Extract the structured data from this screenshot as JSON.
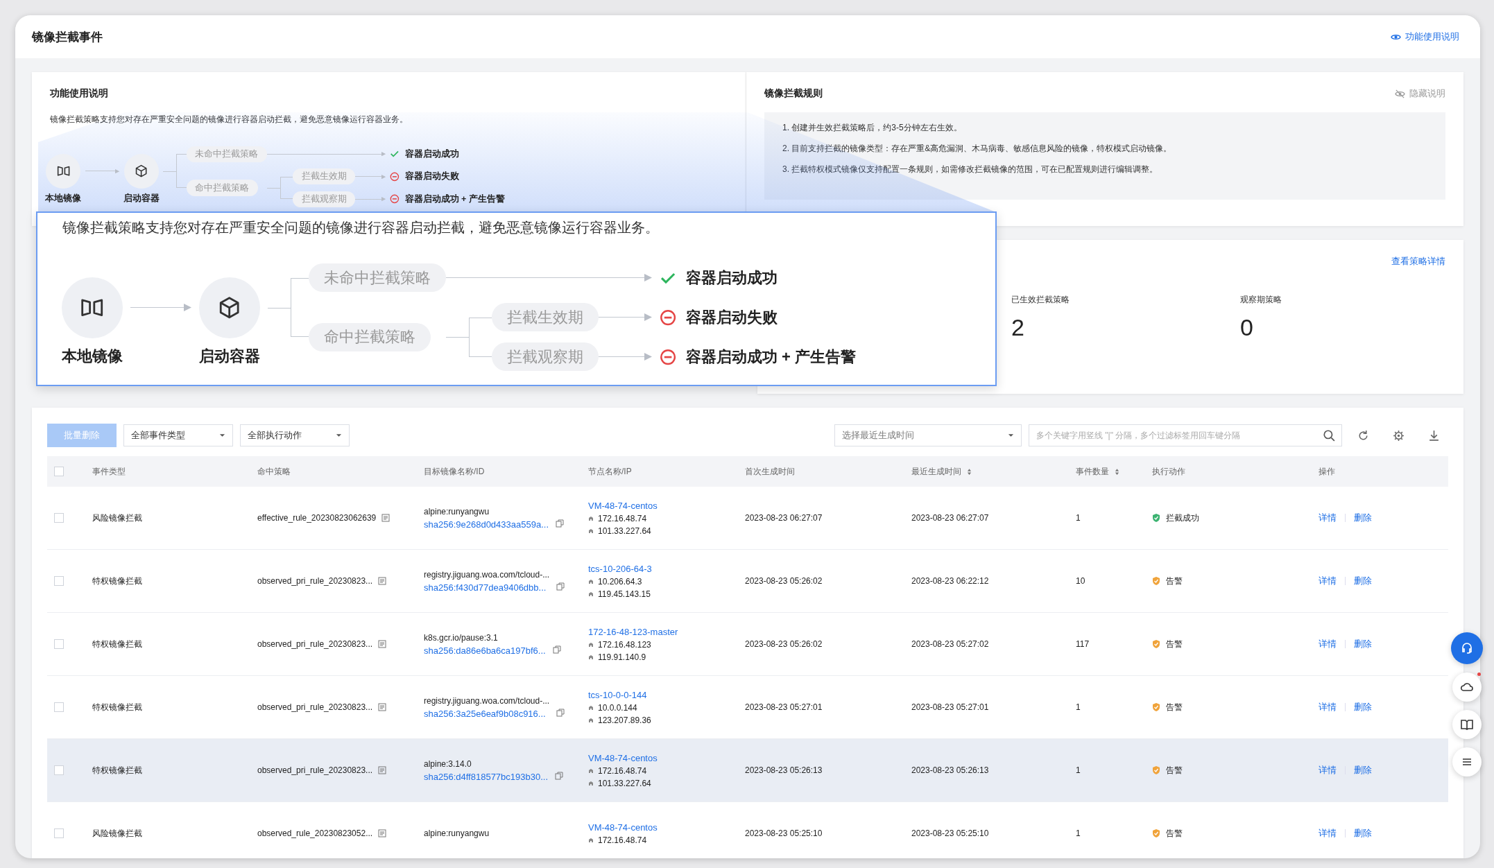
{
  "header": {
    "title": "镜像拦截事件",
    "help_link": "功能使用说明"
  },
  "help": {
    "title": "功能使用说明",
    "description": "镜像拦截策略支持您对存在严重安全问题的镜像进行容器启动拦截，避免恶意镜像运行容器业务。",
    "diagram": {
      "nodes": [
        "本地镜像",
        "启动容器"
      ],
      "miss": {
        "label": "未命中拦截策略",
        "result": {
          "kind": "success",
          "text": "容器启动成功"
        }
      },
      "hit": {
        "label": "命中拦截策略",
        "phases": [
          {
            "label": "拦截生效期",
            "result": {
              "kind": "blocked",
              "text": "容器启动失败"
            }
          },
          {
            "label": "拦截观察期",
            "result": {
              "kind": "blocked",
              "text": "容器启动成功 + 产生告警"
            }
          }
        ]
      }
    }
  },
  "rules": {
    "title": "镜像拦截规则",
    "hide_link": "隐藏说明",
    "items": [
      "1. 创建并生效拦截策略后，约3-5分钟左右生效。",
      "2. 目前支持拦截的镜像类型：存在严重&高危漏洞、木马病毒、敏感信息风险的镜像，特权模式启动镜像。",
      "3. 拦截特权模式镜像仅支持配置一条规则，如需修改拦截镜像的范围，可在已配置规则进行编辑调整。"
    ]
  },
  "stats": {
    "link": "查看策略详情",
    "items": [
      {
        "label": "已生效拦截策略",
        "value": "2"
      },
      {
        "label": "观察期策略",
        "value": "0"
      }
    ]
  },
  "callout": {
    "description": "镜像拦截策略支持您对存在严重安全问题的镜像进行容器启动拦截，避免恶意镜像运行容器业务。",
    "diagram": {
      "nodes": [
        "本地镜像",
        "启动容器"
      ],
      "miss": {
        "label": "未命中拦截策略",
        "result": {
          "kind": "success",
          "text": "容器启动成功"
        }
      },
      "hit": {
        "label": "命中拦截策略",
        "phases": [
          {
            "label": "拦截生效期",
            "result": {
              "kind": "blocked",
              "text": "容器启动失败"
            }
          },
          {
            "label": "拦截观察期",
            "result": {
              "kind": "blocked",
              "text": "容器启动成功 + 产生告警"
            }
          }
        ]
      }
    }
  },
  "toolbar": {
    "batch_delete": {
      "label": "批量删除",
      "disabled": true
    },
    "filters": [
      "全部事件类型",
      "全部执行动作"
    ],
    "time_filter": {
      "placeholder": "选择最近生成时间"
    },
    "search": {
      "placeholder": "多个关键字用竖线 \"|\" 分隔，多个过滤标签用回车键分隔"
    }
  },
  "table": {
    "header_checked": false,
    "columns": [
      {
        "label": "事件类型",
        "sortable": false
      },
      {
        "label": "命中策略",
        "sortable": false
      },
      {
        "label": "目标镜像名称/ID",
        "sortable": false
      },
      {
        "label": "节点名称/IP",
        "sortable": false
      },
      {
        "label": "首次生成时间",
        "sortable": false
      },
      {
        "label": "最近生成时间",
        "sortable": true
      },
      {
        "label": "事件数量",
        "sortable": true
      },
      {
        "label": "执行动作",
        "sortable": false
      },
      {
        "label": "操作",
        "sortable": false
      }
    ],
    "rows": [
      {
        "checked": false,
        "hovered": false,
        "event_type": "风险镜像拦截",
        "policy": "effective_rule_20230823062639",
        "image": {
          "name": "alpine:runyangwu",
          "id": "sha256:9e268d0d433aa559a..."
        },
        "node": {
          "name": "VM-48-74-centos",
          "ips": [
            "172.16.48.74",
            "101.33.227.64"
          ]
        },
        "first_time": "2023-08-23 06:27:07",
        "last_time": "2023-08-23 06:27:07",
        "count": "1",
        "action": {
          "kind": "blocked",
          "text": "拦截成功"
        },
        "operations": [
          "详情",
          "删除"
        ]
      },
      {
        "checked": false,
        "hovered": false,
        "event_type": "特权镜像拦截",
        "policy": "observed_pri_rule_20230823...",
        "image": {
          "name": "registry.jiguang.woa.com/tcloud-...",
          "id": "sha256:f430d77dea9406dbb..."
        },
        "node": {
          "name": "tcs-10-206-64-3",
          "ips": [
            "10.206.64.3",
            "119.45.143.15"
          ]
        },
        "first_time": "2023-08-23 05:26:02",
        "last_time": "2023-08-23 06:22:12",
        "count": "10",
        "action": {
          "kind": "alert",
          "text": "告警"
        },
        "operations": [
          "详情",
          "删除"
        ]
      },
      {
        "checked": false,
        "hovered": false,
        "event_type": "特权镜像拦截",
        "policy": "observed_pri_rule_20230823...",
        "image": {
          "name": "k8s.gcr.io/pause:3.1",
          "id": "sha256:da86e6ba6ca197bf6..."
        },
        "node": {
          "name": "172-16-48-123-master",
          "ips": [
            "172.16.48.123",
            "119.91.140.9"
          ]
        },
        "first_time": "2023-08-23 05:26:02",
        "last_time": "2023-08-23 05:27:02",
        "count": "117",
        "action": {
          "kind": "alert",
          "text": "告警"
        },
        "operations": [
          "详情",
          "删除"
        ]
      },
      {
        "checked": false,
        "hovered": false,
        "event_type": "特权镜像拦截",
        "policy": "observed_pri_rule_20230823...",
        "image": {
          "name": "registry.jiguang.woa.com/tcloud-...",
          "id": "sha256:3a25e6eaf9b08c916..."
        },
        "node": {
          "name": "tcs-10-0-0-144",
          "ips": [
            "10.0.0.144",
            "123.207.89.36"
          ]
        },
        "first_time": "2023-08-23 05:27:01",
        "last_time": "2023-08-23 05:27:01",
        "count": "1",
        "action": {
          "kind": "alert",
          "text": "告警"
        },
        "operations": [
          "详情",
          "删除"
        ]
      },
      {
        "checked": false,
        "hovered": true,
        "event_type": "特权镜像拦截",
        "policy": "observed_pri_rule_20230823...",
        "image": {
          "name": "alpine:3.14.0",
          "id": "sha256:d4ff818577bc193b30..."
        },
        "node": {
          "name": "VM-48-74-centos",
          "ips": [
            "172.16.48.74",
            "101.33.227.64"
          ]
        },
        "first_time": "2023-08-23 05:26:13",
        "last_time": "2023-08-23 05:26:13",
        "count": "1",
        "action": {
          "kind": "alert",
          "text": "告警"
        },
        "operations": [
          "详情",
          "删除"
        ]
      },
      {
        "checked": false,
        "hovered": false,
        "event_type": "风险镜像拦截",
        "policy": "observed_rule_20230823052...",
        "image": {
          "name": "alpine:runyangwu"
        },
        "node": {
          "name": "VM-48-74-centos",
          "ips": [
            "172.16.48.74"
          ]
        },
        "first_time": "2023-08-23 05:25:10",
        "last_time": "2023-08-23 05:25:10",
        "count": "1",
        "action": {
          "kind": "alert",
          "text": "告警"
        },
        "operations": [
          "详情",
          "删除"
        ]
      }
    ]
  }
}
